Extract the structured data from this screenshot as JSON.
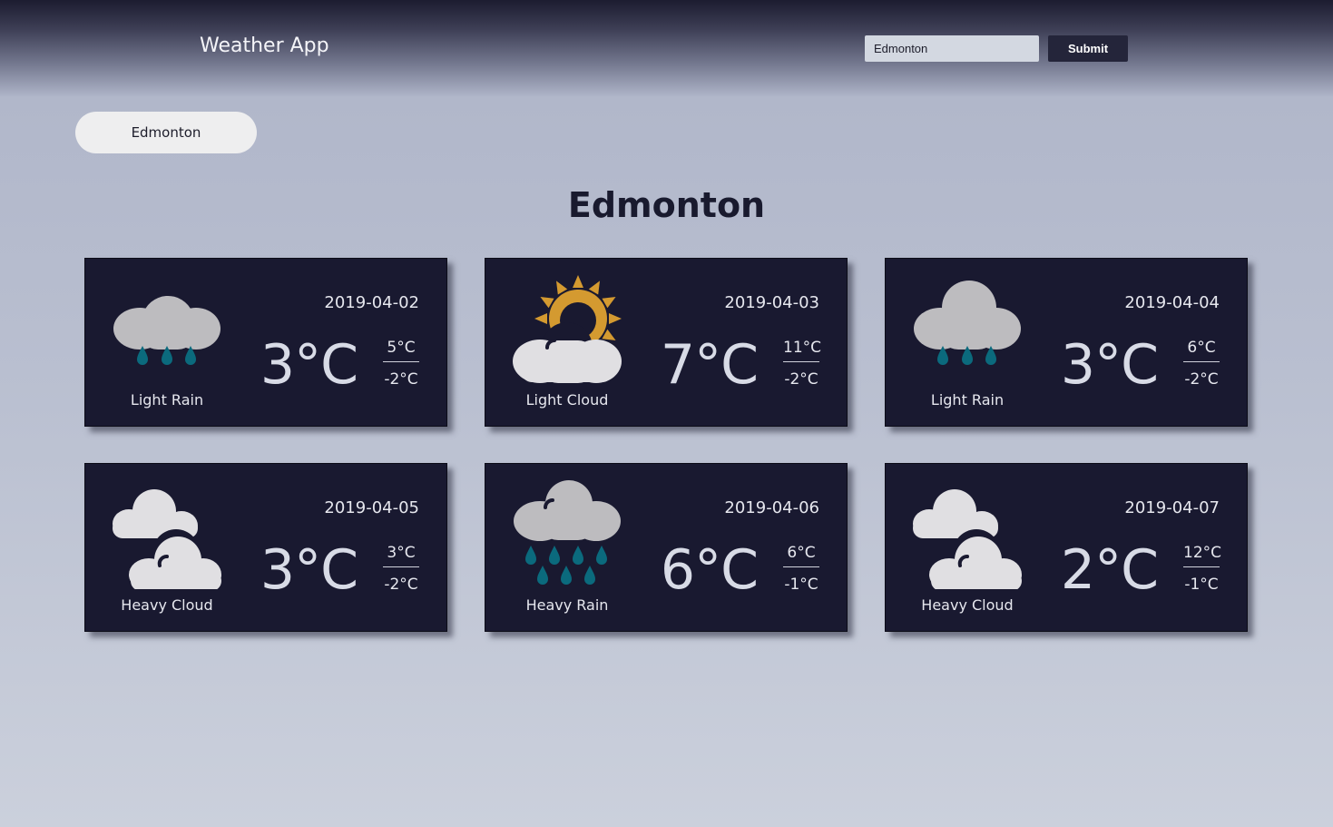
{
  "header": {
    "app_title": "Weather App",
    "search_value": "Edmonton",
    "submit_label": "Submit"
  },
  "city_chip": "Edmonton",
  "city_heading": "Edmonton",
  "colors": {
    "card_background": "#191930",
    "rain_drop": "#0b6a7d",
    "sun": "#d49a30",
    "cloud_light": "#e0dfe2",
    "cloud_dark": "#bdbcbf"
  },
  "forecast": [
    {
      "date": "2019-04-02",
      "temp": "3°C",
      "high": "5°C",
      "low": "-2°C",
      "description": "Light Rain",
      "icon": "light-rain-icon"
    },
    {
      "date": "2019-04-03",
      "temp": "7°C",
      "high": "11°C",
      "low": "-2°C",
      "description": "Light Cloud",
      "icon": "light-cloud-icon"
    },
    {
      "date": "2019-04-04",
      "temp": "3°C",
      "high": "6°C",
      "low": "-2°C",
      "description": "Light Rain",
      "icon": "light-rain-icon"
    },
    {
      "date": "2019-04-05",
      "temp": "3°C",
      "high": "3°C",
      "low": "-2°C",
      "description": "Heavy Cloud",
      "icon": "heavy-cloud-icon"
    },
    {
      "date": "2019-04-06",
      "temp": "6°C",
      "high": "6°C",
      "low": "-1°C",
      "description": "Heavy Rain",
      "icon": "heavy-rain-icon"
    },
    {
      "date": "2019-04-07",
      "temp": "2°C",
      "high": "12°C",
      "low": "-1°C",
      "description": "Heavy Cloud",
      "icon": "heavy-cloud-icon"
    }
  ]
}
